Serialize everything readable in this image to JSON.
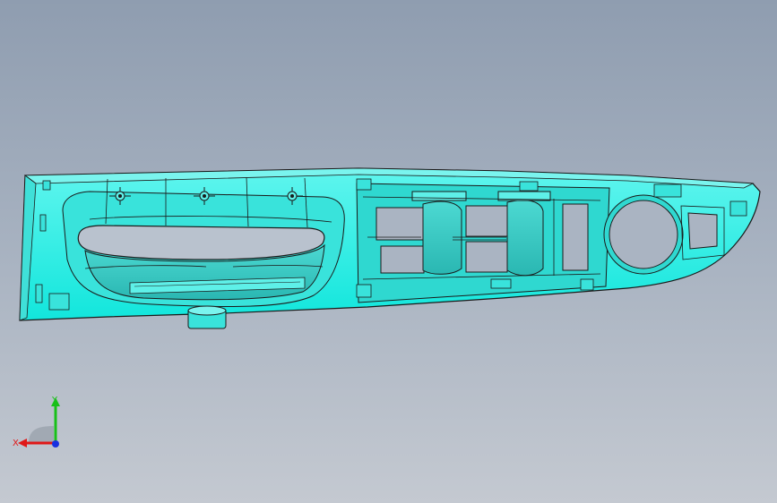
{
  "viewport": {
    "background_top": "#8f9db0",
    "background_bottom": "#c4c9d1"
  },
  "model": {
    "icon": "door-armrest-panel-3d-model",
    "fill_color": "#00ffee",
    "edge_color": "#1a1a1a"
  },
  "triad": {
    "x_label": "X",
    "y_label": "Y",
    "x_color": "#e01818",
    "y_color": "#18c018",
    "z_color": "#1830e0"
  }
}
